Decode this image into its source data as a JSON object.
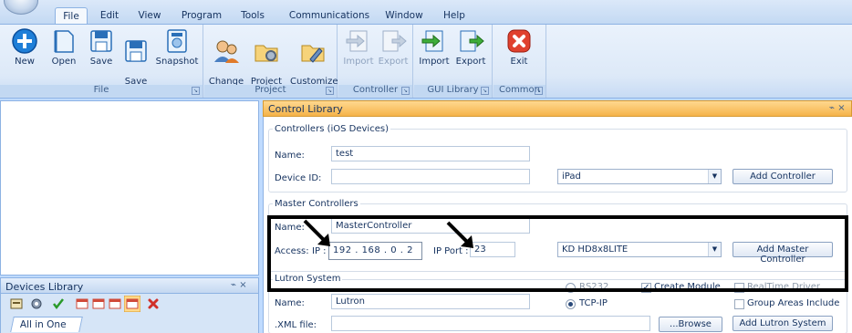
{
  "menu": {
    "tabs": [
      "File",
      "Edit",
      "View",
      "Program",
      "Tools",
      "Communications",
      "Window",
      "Help"
    ]
  },
  "ribbon": {
    "groups": [
      {
        "label": "File",
        "buttons": [
          {
            "label": "New",
            "icon": "new-icon"
          },
          {
            "label": "Open",
            "icon": "open-icon"
          },
          {
            "label": "Save",
            "icon": "save-icon"
          },
          {
            "label": "Save\nAs",
            "icon": "save-as-icon"
          },
          {
            "label": "Snapshot",
            "icon": "snapshot-icon"
          }
        ]
      },
      {
        "label": "Project",
        "buttons": [
          {
            "label": "Change\nUser",
            "icon": "change-user-icon"
          },
          {
            "label": "Project\nSettings",
            "icon": "project-settings-icon"
          },
          {
            "label": "Customize\nProject",
            "icon": "customize-project-icon"
          }
        ]
      },
      {
        "label": "Controller",
        "buttons": [
          {
            "label": "Import",
            "icon": "import-icon"
          },
          {
            "label": "Export",
            "icon": "export-icon"
          }
        ]
      },
      {
        "label": "GUI Library",
        "buttons": [
          {
            "label": "Import",
            "icon": "import-icon"
          },
          {
            "label": "Export",
            "icon": "export-icon"
          }
        ]
      },
      {
        "label": "Common",
        "buttons": [
          {
            "label": "Exit",
            "icon": "exit-icon"
          }
        ]
      }
    ]
  },
  "devices_library": {
    "title": "Devices Library",
    "pin": "⌁ ×",
    "tab": "All in One",
    "toolbar_icons": [
      "device-list-icon",
      "gear-icon",
      "check-icon",
      "window-icon",
      "window-icon",
      "window-icon",
      "window-add-icon",
      "delete-icon"
    ]
  },
  "control_library": {
    "title": "Control Library",
    "pin": "⌁ ×",
    "controllers": {
      "legend": "Controllers (iOS Devices)",
      "name_label": "Name:",
      "name_value": "test",
      "device_id_label": "Device ID:",
      "device_id_value": "",
      "device_type": "iPad",
      "add_button": "Add Controller"
    },
    "master": {
      "legend": "Master Controllers",
      "name_label": "Name:",
      "name_value": "MasterController",
      "access_label": "Access:",
      "ip_label": "IP :",
      "ip_value": "192 . 168 . 0  .  2",
      "port_label": "IP Port :",
      "port_value": "23",
      "model": "KD HD8x8LITE",
      "add_button": "Add Master Controller"
    },
    "lutron": {
      "legend": "Lutron System",
      "rs232_label": "RS232",
      "create_module_label": "Create Module",
      "create_module_checked": true,
      "realtime_label": "RealTime Driver",
      "tcpip_label": "TCP-IP",
      "tcpip_selected": true,
      "group_areas_label": "Group Areas Include",
      "name_label": "Name:",
      "name_value": "Lutron",
      "xml_label": ".XML file:",
      "xml_value": "",
      "browse_button": "...Browse",
      "add_button": "Add Lutron System"
    }
  }
}
